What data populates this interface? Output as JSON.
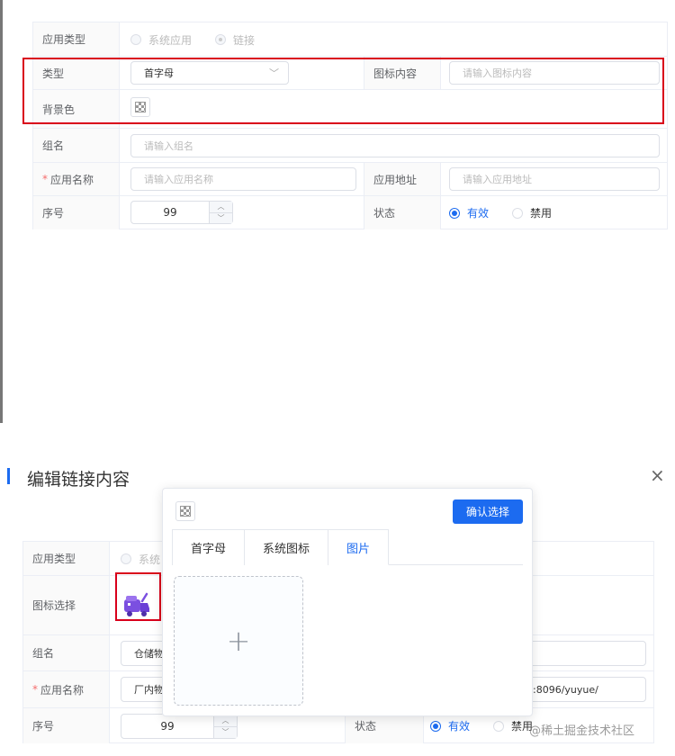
{
  "form_top": {
    "app_type_label": "应用类型",
    "app_type_options": [
      "系统应用",
      "链接"
    ],
    "type_label": "类型",
    "type_value": "首字母",
    "icon_content_label": "图标内容",
    "icon_content_placeholder": "请输入图标内容",
    "bg_color_label": "背景色",
    "group_label": "组名",
    "group_placeholder": "请输入组名",
    "app_name_label": "应用名称",
    "required_mark": "*",
    "app_name_placeholder": "请输入应用名称",
    "app_url_label": "应用地址",
    "app_url_placeholder": "请输入应用地址",
    "order_label": "序号",
    "order_value": "99",
    "status_label": "状态",
    "status_options": [
      "有效",
      "禁用"
    ]
  },
  "dialog": {
    "title": "编辑链接内容",
    "close_icon": "×",
    "app_type_label": "应用类型",
    "app_type_partial": "系统",
    "icon_select_label": "图标选择",
    "group_label": "组名",
    "group_value_partial": "仓储物",
    "app_name_label": "应用名称",
    "app_name_value_partial": "厂内物",
    "app_url_value_partial": ":8096/yuyue/",
    "order_label": "序号",
    "order_value": "99",
    "status_label": "状态",
    "status_options": [
      "有效",
      "禁用"
    ]
  },
  "popover": {
    "confirm_label": "确认选择",
    "tabs": [
      "首字母",
      "系统图标",
      "图片"
    ],
    "upload_plus": "+"
  },
  "watermark": "@稀土掘金技术社区",
  "colors": {
    "primary": "#1c6bf0",
    "highlight": "#d9001b",
    "icon_purple": "#7b4fe0"
  }
}
